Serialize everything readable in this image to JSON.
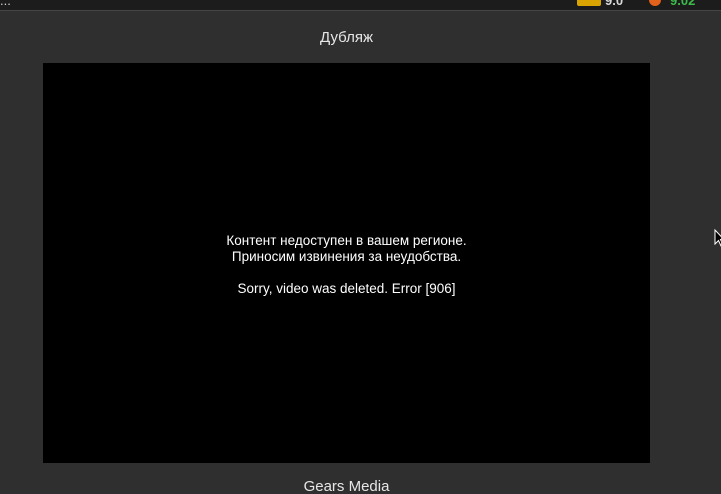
{
  "topbar": {
    "left_fragment": "...",
    "rating_1": "9.0",
    "rating_2": "9.02"
  },
  "section": {
    "title": "Дубляж"
  },
  "player": {
    "message_line_1": "Контент недоступен в вашем регионе.",
    "message_line_2": "Приносим извинения за неудобства.",
    "error_line": "Sorry, video was deleted. Error [906]"
  },
  "footer": {
    "caption": "Gears Media"
  },
  "colors": {
    "page_background": "#2f2f2f",
    "player_background": "#000000",
    "rating_1_badge": "#d9a400",
    "rating_2_icon": "#e2621b",
    "rating_2_text": "#3dbb4a"
  },
  "icons": {
    "rating_1": "rating-badge-icon",
    "rating_2": "rating-logo-icon",
    "cursor": "mouse-pointer-icon"
  }
}
